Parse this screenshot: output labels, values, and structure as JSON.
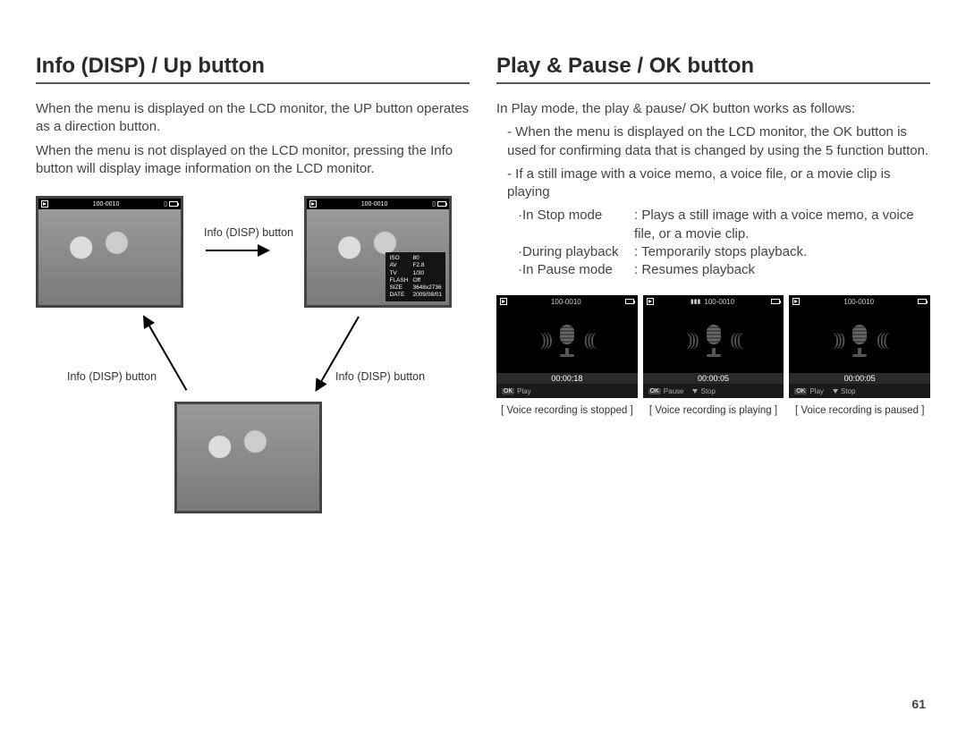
{
  "page_number": "61",
  "left": {
    "title": "Info (DISP) / Up button",
    "para1": "When the menu is displayed on the LCD monitor, the UP button operates as a direction button.",
    "para2": "When the menu is not displayed on the LCD monitor, pressing the Info button will display image information on the LCD monitor.",
    "arrow_label": "Info (DISP) button",
    "file_counter": "100-0010",
    "info_overlay": {
      "iso_label": "ISO",
      "iso": "80",
      "av_label": "AV",
      "av": "F2.8",
      "tv_label": "TV",
      "tv": "1/30",
      "flash_label": "FLASH",
      "flash": "Off",
      "size_label": "SIZE",
      "size": "3648x2736",
      "date_label": "DATE",
      "date": "2009/08/01"
    }
  },
  "right": {
    "title": "Play & Pause / OK button",
    "intro": "In Play mode, the play & pause/ OK button works as follows:",
    "bullet1": "- When the menu is displayed on the LCD monitor, the OK button is used for confirming data that is changed by using the 5 function button.",
    "bullet2": "- If a still image with a voice memo, a voice file, or a movie clip is playing",
    "modes": [
      {
        "label": "·In Stop mode",
        "value": ": Plays a still image with a voice memo, a voice file, or a movie clip."
      },
      {
        "label": "·During playback",
        "value": ": Temporarily stops playback."
      },
      {
        "label": "·In Pause mode",
        "value": ": Resumes playback"
      }
    ],
    "file_counter": "100-0010",
    "shots": [
      {
        "time": "00:00:18",
        "left_key": "OK",
        "left_label": "Play",
        "right_icon": "",
        "right_label": ""
      },
      {
        "time": "00:00:05",
        "left_key": "OK",
        "left_label": "Pause",
        "right_icon": "stop",
        "right_label": "Stop"
      },
      {
        "time": "00:00:05",
        "left_key": "OK",
        "left_label": "Play",
        "right_icon": "stop",
        "right_label": "Stop"
      }
    ],
    "captions": [
      "[ Voice recording is stopped ]",
      "[ Voice recording is playing ]",
      "[ Voice recording is paused ]"
    ]
  }
}
